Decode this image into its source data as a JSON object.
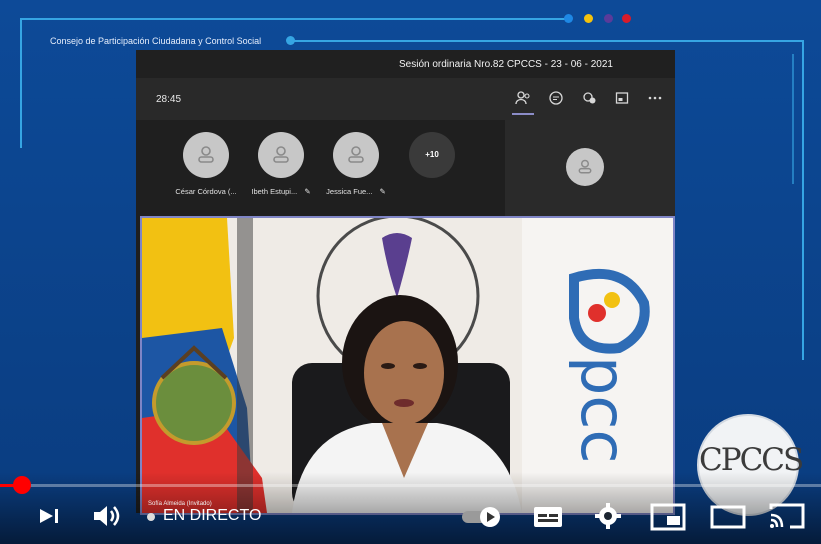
{
  "broadcast": {
    "organization": "Consejo de Participación Ciudadana y Control Social",
    "accent_color": "#36a5e3",
    "decor_dots": [
      "#1e88e5",
      "#f4c20d",
      "#5a3b9a",
      "#d81b2a"
    ],
    "logo_text": "CPCCS"
  },
  "meeting": {
    "title": "Sesión ordinaria Nro.82 CPCCS - 23 - 06 - 2021",
    "timer": "28:45",
    "toolbar_icons": [
      "people-icon",
      "chat-icon",
      "raise-hand-icon",
      "share-icon",
      "more-icon"
    ],
    "participants": [
      {
        "name": "César Córdova (...",
        "muted": false
      },
      {
        "name": "Ibeth Estupi...",
        "muted": true
      },
      {
        "name": "Jessica Fue...",
        "muted": true
      }
    ],
    "overflow_count": "+10",
    "speaker_caption": "Sofía Almeida (Invitado)"
  },
  "player": {
    "progress": 0.027,
    "progress_color": "#ff0000",
    "live_label": "EN DIRECTO",
    "icons": [
      "next-icon",
      "volume-icon",
      "autoplay-toggle-icon",
      "subtitles-icon",
      "settings-icon",
      "miniplayer-icon",
      "theater-icon",
      "cast-icon"
    ]
  }
}
